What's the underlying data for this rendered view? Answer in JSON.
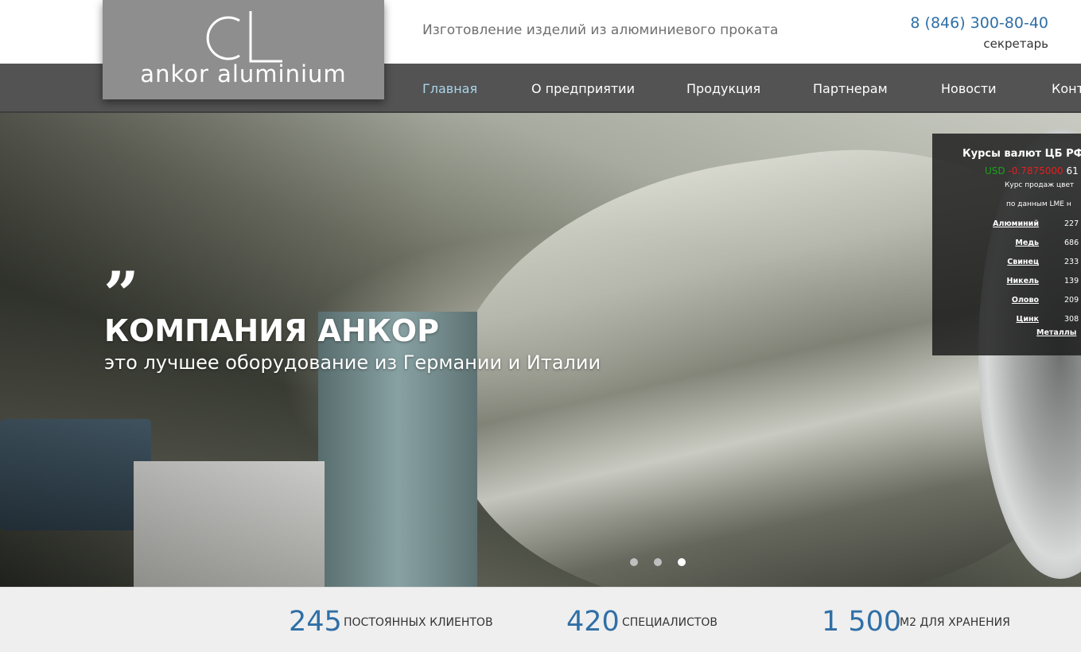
{
  "header": {
    "logo_text": "ankor aluminium",
    "tagline": "Изготовление изделий из алюминиевого проката",
    "phone": "8 (846) 300-80-40",
    "phone_note": "секретарь"
  },
  "nav": {
    "items": [
      {
        "label": "Главная",
        "active": true
      },
      {
        "label": "О предприятии"
      },
      {
        "label": "Продукция"
      },
      {
        "label": "Партнерам"
      },
      {
        "label": "Новости"
      },
      {
        "label": "Конт"
      }
    ]
  },
  "hero": {
    "quote": "”",
    "title": "КОМПАНИЯ АНКОР",
    "subtitle": "это лучшее оборудование из Германии и Италии",
    "slides_total": 3,
    "active_slide": 3
  },
  "widget": {
    "title": "Курсы валют ЦБ РФ I",
    "currency_code": "USD",
    "currency_change": "-0.7875000",
    "currency_rate": "61",
    "note_line1": "Курс продаж цвет",
    "note_line2": "по данным LME н",
    "metals": [
      {
        "name": "Алюминий",
        "value": "227"
      },
      {
        "name": "Медь",
        "value": "686"
      },
      {
        "name": "Свинец",
        "value": "233"
      },
      {
        "name": "Никель",
        "value": "139"
      },
      {
        "name": "Олово",
        "value": "209"
      },
      {
        "name": "Цинк",
        "value": "308"
      }
    ],
    "link": "Металлы"
  },
  "stats": [
    {
      "number": "245",
      "label": "ПОСТОЯННЫХ КЛИЕНТОВ"
    },
    {
      "number": "420",
      "label": "СПЕЦИАЛИСТОВ"
    },
    {
      "number": "1 500",
      "label": "М2 ДЛЯ ХРАНЕНИЯ"
    }
  ],
  "colors": {
    "accent_blue": "#2f6fa6",
    "nav_bg": "#535353",
    "nav_active": "#a9d4ea",
    "logo_bg": "#8e8e8e",
    "stats_bg": "#efefef"
  }
}
